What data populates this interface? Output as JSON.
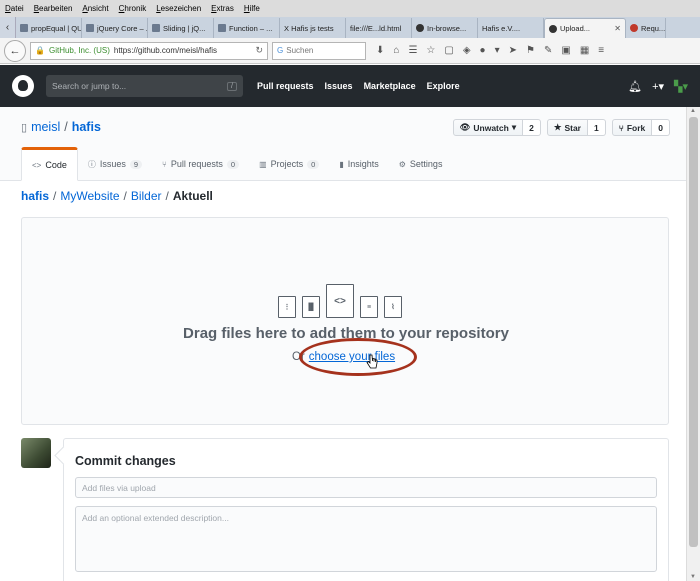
{
  "browser": {
    "menu": [
      "Datei",
      "Bearbeiten",
      "Ansicht",
      "Chronik",
      "Lesezeichen",
      "Extras",
      "Hilfe"
    ],
    "tabs": [
      {
        "label": "propEqual | QU...",
        "active": false
      },
      {
        "label": "jQuery Core – ...",
        "active": false
      },
      {
        "label": "Sliding | jQ...",
        "active": false
      },
      {
        "label": "Function – ...",
        "active": false
      },
      {
        "label": "X Hafis js tests",
        "active": false
      },
      {
        "label": "file:///E...ld.html",
        "active": false
      },
      {
        "label": "In-browse...",
        "active": false
      },
      {
        "label": "Hafis e.V....",
        "active": false
      },
      {
        "label": "Upload...",
        "active": true
      },
      {
        "label": "Requ...",
        "active": false
      }
    ],
    "url_company": "GitHub, Inc. (US)",
    "url": "https://github.com/meisl/hafis",
    "search_placeholder": "Suchen"
  },
  "github": {
    "search_placeholder": "Search or jump to...",
    "search_hint": "/",
    "nav": [
      "Pull requests",
      "Issues",
      "Marketplace",
      "Explore"
    ],
    "header_icons": [
      "bell-icon",
      "plus-icon",
      "user-icon"
    ]
  },
  "repo": {
    "owner": "meisl",
    "name": "hafis",
    "watch_label": "Unwatch",
    "watch_count": "2",
    "star_label": "Star",
    "star_count": "1",
    "fork_label": "Fork",
    "fork_count": "0",
    "tabs": [
      {
        "label": "Code",
        "count": "",
        "icon": "code-icon"
      },
      {
        "label": "Issues",
        "count": "9",
        "icon": "issue-icon"
      },
      {
        "label": "Pull requests",
        "count": "0",
        "icon": "pr-icon"
      },
      {
        "label": "Projects",
        "count": "0",
        "icon": "project-icon"
      },
      {
        "label": "Insights",
        "count": "",
        "icon": "graph-icon"
      },
      {
        "label": "Settings",
        "count": "",
        "icon": "gear-icon"
      }
    ]
  },
  "breadcrumb": {
    "root": "hafis",
    "parts": [
      "MyWebsite",
      "Bilder"
    ],
    "current": "Aktuell"
  },
  "upload": {
    "title": "Drag files here to add them to your repository",
    "or": "Or",
    "choose_label": "choose your files",
    "highlight_color": "#a5321d"
  },
  "commit": {
    "title": "Commit changes",
    "summary_placeholder": "Add files via upload",
    "description_placeholder": "Add an optional extended description..."
  }
}
